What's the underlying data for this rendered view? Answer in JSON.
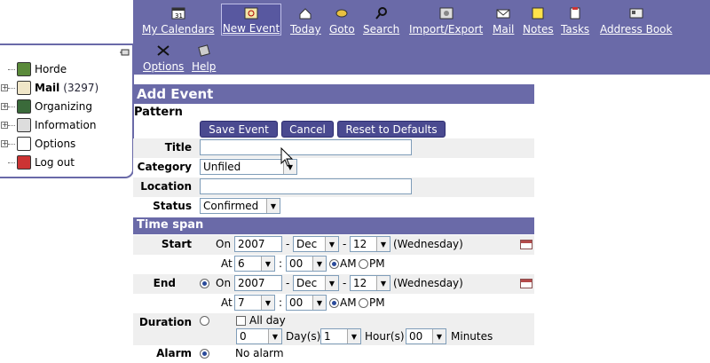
{
  "toolbar": {
    "items": [
      {
        "label": "My Calendars",
        "icon": "calendar-icon"
      },
      {
        "label": "New Event",
        "icon": "new-event-icon"
      },
      {
        "label": "Today",
        "icon": "today-icon"
      },
      {
        "label": "Goto",
        "icon": "goto-icon"
      },
      {
        "label": "Search",
        "icon": "search-icon"
      },
      {
        "label": "Import/Export",
        "icon": "import-export-icon"
      },
      {
        "label": "Mail",
        "icon": "mail-icon"
      },
      {
        "label": "Notes",
        "icon": "notes-icon"
      },
      {
        "label": "Tasks",
        "icon": "tasks-icon"
      },
      {
        "label": "Address Book",
        "icon": "address-book-icon"
      }
    ],
    "row2": [
      {
        "label": "Options",
        "icon": "options-icon"
      },
      {
        "label": "Help",
        "icon": "help-icon"
      }
    ]
  },
  "sidebar": {
    "items": [
      {
        "label": "Horde"
      },
      {
        "label": "Mail",
        "count": "(3297)"
      },
      {
        "label": "Organizing"
      },
      {
        "label": "Information"
      },
      {
        "label": "Options"
      },
      {
        "label": "Log out"
      }
    ]
  },
  "form": {
    "heading": "Add Event",
    "pattern": "Pattern",
    "buttons": {
      "save": "Save Event",
      "cancel": "Cancel",
      "reset": "Reset to Defaults"
    },
    "title_label": "Title",
    "title_value": "",
    "category_label": "Category",
    "category_value": "Unfiled",
    "location_label": "Location",
    "location_value": "",
    "status_label": "Status",
    "status_value": "Confirmed",
    "timespan_heading": "Time span",
    "start": {
      "label": "Start",
      "on": "On",
      "year": "2007",
      "month": "Dec",
      "day": "12",
      "weekday": "(Wednesday)",
      "at": "At",
      "hour": "6",
      "minute": "00",
      "am": "AM",
      "pm": "PM"
    },
    "end": {
      "label": "End",
      "on": "On",
      "year": "2007",
      "month": "Dec",
      "day": "12",
      "weekday": "(Wednesday)",
      "at": "At",
      "hour": "7",
      "minute": "00",
      "am": "AM",
      "pm": "PM"
    },
    "duration": {
      "label": "Duration",
      "allday": "All day",
      "days": "0",
      "days_label": "Day(s)",
      "hours": "1",
      "hours_label": "Hour(s)",
      "minutes": "00",
      "minutes_label": "Minutes"
    },
    "alarm": {
      "label": "Alarm",
      "value": "No alarm"
    },
    "colon": ":",
    "dash": "-"
  },
  "colors": {
    "accent": "#6a6aa8",
    "button": "#4a4a90",
    "row": "#efefef"
  }
}
